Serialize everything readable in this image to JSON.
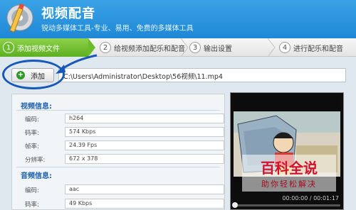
{
  "header": {
    "title": "视频配音",
    "subtitle": "锐动多媒体工具-专业、易用、免费的多媒体工具"
  },
  "steps": [
    {
      "num": "1",
      "label": "添加视频文件",
      "active": true
    },
    {
      "num": "2",
      "label": "给视频添加配乐和配音",
      "active": false
    },
    {
      "num": "3",
      "label": "输出设置",
      "active": false
    },
    {
      "num": "4",
      "label": "进行配乐和配音",
      "active": false
    }
  ],
  "add_button": {
    "label": "添加"
  },
  "file_path": "C:\\Users\\Administrator\\Desktop\\56视频\\11.mp4",
  "video_info": {
    "title": "视频信息:",
    "rows": [
      {
        "label": "编码:",
        "value": "h264"
      },
      {
        "label": "码率:",
        "value": "574 Kbps"
      },
      {
        "label": "帧率:",
        "value": "24.39 Fps"
      },
      {
        "label": "分辨率:",
        "value": "672 x 378"
      }
    ]
  },
  "audio_info": {
    "title": "音频信息:",
    "rows": [
      {
        "label": "编码:",
        "value": "aac"
      },
      {
        "label": "码率:",
        "value": "49 Kbps"
      }
    ]
  },
  "player": {
    "time": "00:00:00 / 00:01:17",
    "progress": 0
  },
  "watermark": {
    "title": "百科全说",
    "subtitle": "助你轻松解决"
  },
  "colors": {
    "header": "#1f88d6",
    "active_step": "#5daf22",
    "annotation": "#1858b8",
    "watermark": "#d4102a"
  }
}
